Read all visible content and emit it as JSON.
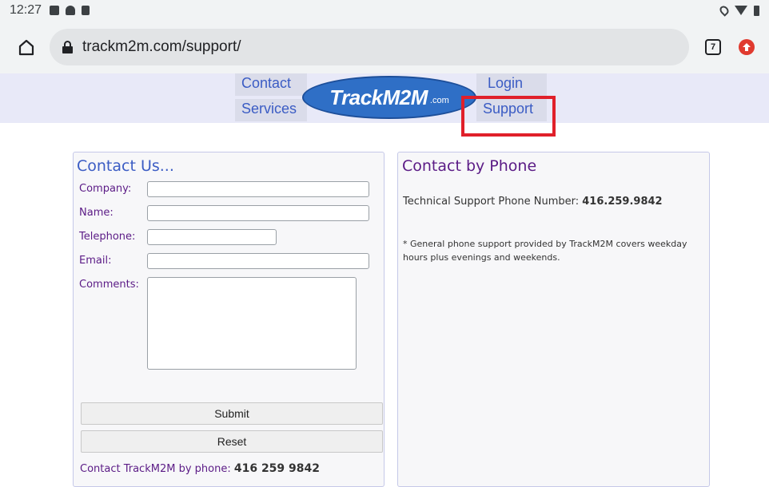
{
  "status_bar": {
    "time": "12:27"
  },
  "browser": {
    "url": "trackm2m.com/support/",
    "tab_count": "7"
  },
  "header": {
    "nav_contact": "Contact",
    "nav_services": "Services",
    "nav_login": "Login",
    "nav_support": "Support",
    "logo_text": "TrackM2M",
    "logo_suffix": ".com"
  },
  "contact_form": {
    "title": "Contact Us...",
    "company_label": "Company:",
    "name_label": "Name:",
    "telephone_label": "Telephone:",
    "email_label": "Email:",
    "comments_label": "Comments:",
    "submit_label": "Submit",
    "reset_label": "Reset",
    "phone_prefix": "Contact TrackM2M by phone:",
    "phone_number": "416 259 9842"
  },
  "phone_panel": {
    "title": "Contact by Phone",
    "support_label": "Technical Support Phone Number:",
    "support_number": "416.259.9842",
    "note": "* General phone support provided by TrackM2M covers weekday hours plus evenings and weekends."
  },
  "colors": {
    "accent_blue": "#3b5cc4",
    "heading_purple": "#5b1b86",
    "highlight_red": "#e0202a",
    "logo_blue": "#2f6fc6"
  }
}
